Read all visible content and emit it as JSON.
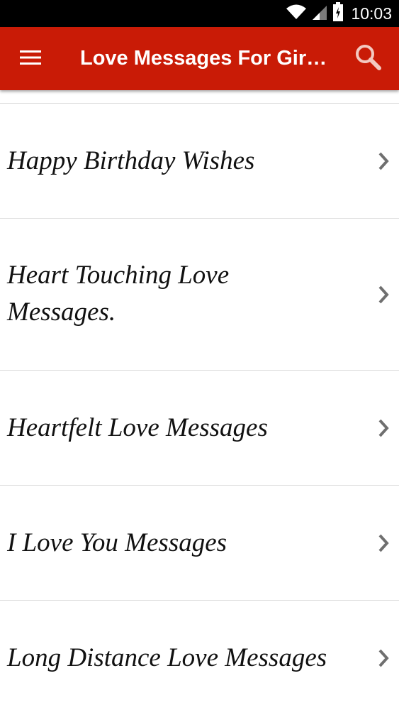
{
  "status_bar": {
    "time": "10:03",
    "icons": [
      "wifi-icon",
      "signal-icon",
      "battery-icon"
    ]
  },
  "app_bar": {
    "title": "Love Messages For Gir…",
    "background_color": "#c91b06",
    "icons": [
      "menu-icon",
      "search-icon"
    ]
  },
  "list": {
    "items": [
      {
        "label": "Happy Birthday  Wishes"
      },
      {
        "label": "Heart Touching Love Messages."
      },
      {
        "label": "Heartfelt Love Messages"
      },
      {
        "label": "I Love  You Messages"
      },
      {
        "label": "Long Distance Love Messages"
      }
    ]
  }
}
